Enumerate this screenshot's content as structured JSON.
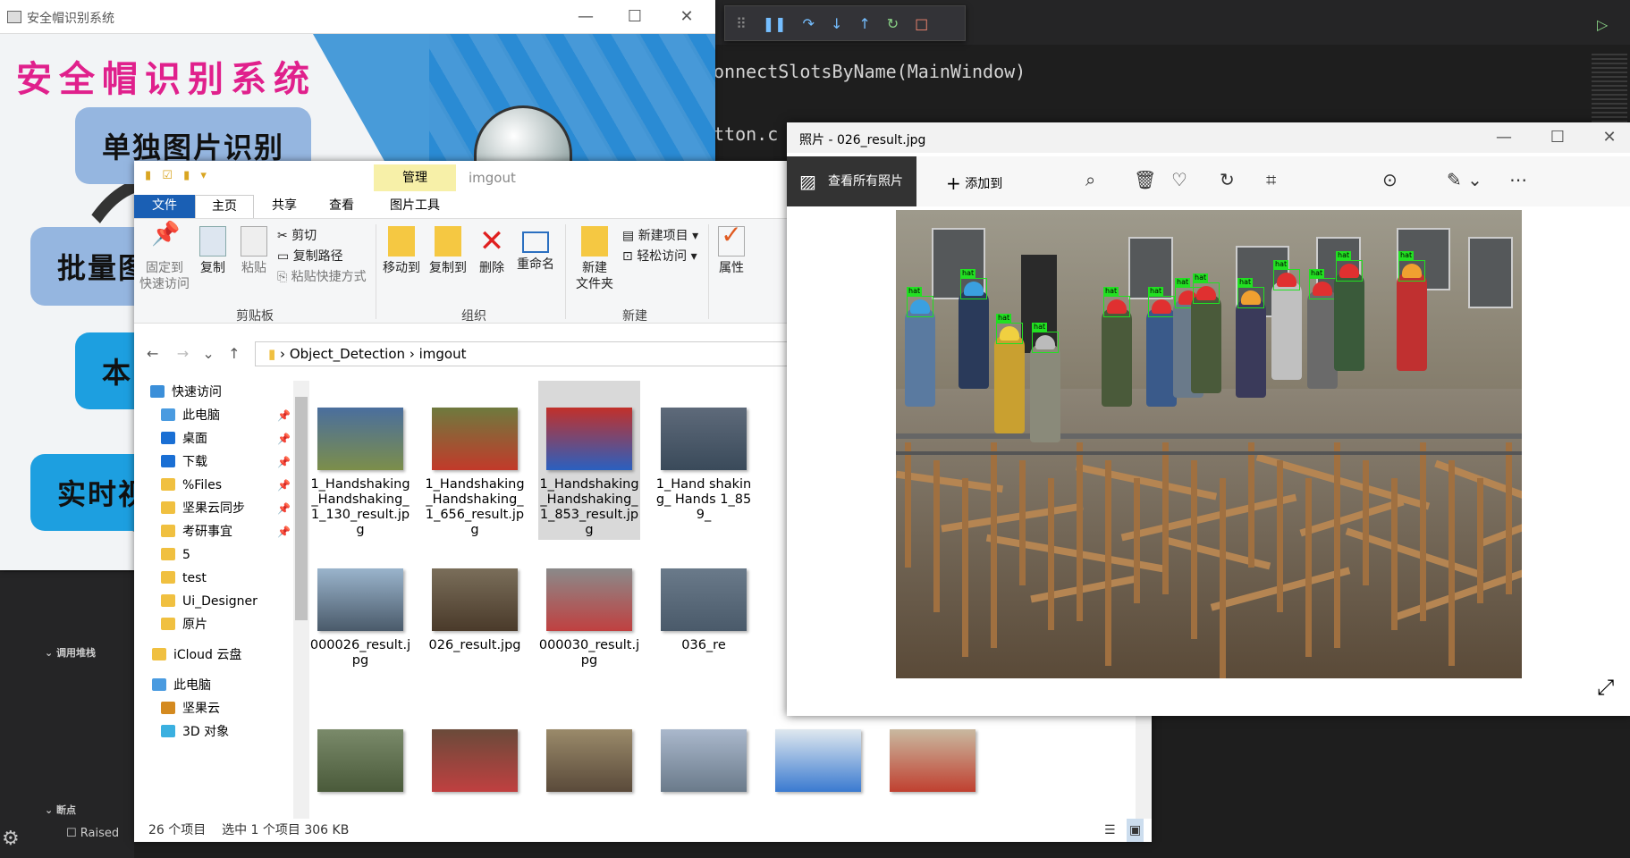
{
  "vscode": {
    "code_line1": "onnectSlotsByName(MainWindow)",
    "code_line2": "tton.c",
    "callstack_label": "调用堆栈",
    "breakpoints_label": "断点",
    "raised_label": "Raised"
  },
  "app": {
    "window_title": "安全帽识别系统",
    "heading": "安全帽识别系统",
    "buttons": [
      "单独图片识别",
      "批量图",
      "本",
      "实时视"
    ]
  },
  "explorer": {
    "quick_access_icons": "▮ ☑ ▮ ▾",
    "manage_label": "管理",
    "folder_title": "imgout",
    "tabs": {
      "file": "文件",
      "home": "主页",
      "share": "共享",
      "view": "查看",
      "tools": "图片工具"
    },
    "ribbon": {
      "pin": "固定到\n快速访问",
      "copy": "复制",
      "paste": "粘贴",
      "cut": "剪切",
      "copy_path": "复制路径",
      "paste_shortcut": "粘贴快捷方式",
      "clipboard_group": "剪贴板",
      "move_to": "移动到",
      "copy_to": "复制到",
      "delete": "删除",
      "rename": "重命名",
      "organize_group": "组织",
      "new_folder": "新建\n文件夹",
      "new_item": "新建项目",
      "easy_access": "轻松访问",
      "new_group": "新建",
      "properties": "属性"
    },
    "breadcrumb": [
      "Object_Detection",
      "imgout"
    ],
    "nav": [
      {
        "label": "快速访问",
        "pinned": false
      },
      {
        "label": "此电脑",
        "pinned": true
      },
      {
        "label": "桌面",
        "pinned": true
      },
      {
        "label": "下载",
        "pinned": true
      },
      {
        "label": "%Files",
        "pinned": true
      },
      {
        "label": "坚果云同步",
        "pinned": true
      },
      {
        "label": "考研事宜",
        "pinned": true
      },
      {
        "label": "5",
        "pinned": false
      },
      {
        "label": "test",
        "pinned": false
      },
      {
        "label": "Ui_Designer",
        "pinned": false
      },
      {
        "label": "原片",
        "pinned": false
      },
      {
        "label": "iCloud 云盘",
        "pinned": false
      },
      {
        "label": "此电脑",
        "pinned": false
      },
      {
        "label": "坚果云",
        "pinned": false
      },
      {
        "label": "3D 对象",
        "pinned": false
      }
    ],
    "files_row1": [
      "1_Handshaking_Handshaking_1_130_result.jpg",
      "1_Handshaking_Handshaking_1_656_result.jpg",
      "1_Handshaking_Handshaking_1_853_result.jpg",
      "1_Hand shaking_ Hands 1_859_"
    ],
    "files_row2": [
      "000026_result.jpg",
      "026_result.jpg",
      "000030_result.jpg",
      "036_re"
    ],
    "status_count": "26 个项目",
    "status_selection": "选中 1 个项目  306 KB"
  },
  "photos": {
    "title": "照片 - 026_result.jpg",
    "view_all": "查看所有照片",
    "add_to": "添加到",
    "detection_label": "hat"
  },
  "colors": {
    "accent_blue": "#1a5fb4",
    "app_magenta": "#e0208c",
    "detect_green": "#22e022"
  }
}
